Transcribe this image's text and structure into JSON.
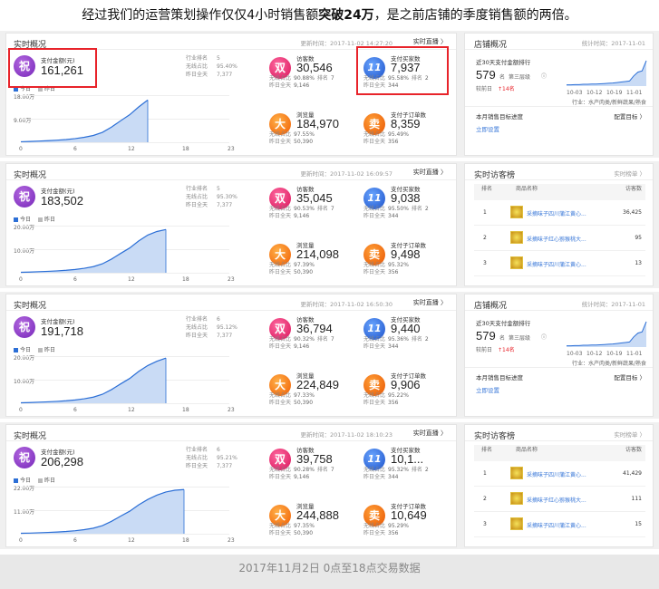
{
  "headline": {
    "prefix": "经过我们的运营策划操作仅仅4小时销售额",
    "bold": "突破24万",
    "suffix": "，是之前店铺的季度销售额的两倍。"
  },
  "colors": {
    "today": "#2c6fd6",
    "yesterday": "#bbbbbb",
    "fill": "#c9dbf5",
    "highlight": "#e8232a",
    "link": "#3a78d8"
  },
  "labels": {
    "realtime": "实时概况",
    "live": "实时直播 〉",
    "pay_amount": "支付金额(元)",
    "industry_rank": "行业排名",
    "wireless_ratio": "无线占比",
    "yesterday_all": "昨日全天",
    "today": "今日",
    "yesterday": "昨日",
    "visitors": "访客数",
    "buyers": "支付买家数",
    "pageviews": "浏览量",
    "orders": "支付子订单数",
    "rank": "排名",
    "badge_zhu": "祝",
    "badge_shuang": "双",
    "badge_11": "11",
    "badge_da": "大",
    "badge_mai": "卖"
  },
  "axis": {
    "x": [
      "0",
      "6",
      "12",
      "18",
      "23"
    ]
  },
  "rows": [
    {
      "update_time": "更新时间：2017-11-02 14:27:20",
      "pay_amount": "161,261",
      "industry_rank": "5",
      "wireless_ratio": "95.40%",
      "yesterday": "7,377",
      "y_ticks": [
        "18.00万",
        "9.00万"
      ],
      "y_max": 180000,
      "series": [
        [
          0,
          2000
        ],
        [
          1,
          3000
        ],
        [
          2,
          4500
        ],
        [
          3,
          6000
        ],
        [
          4,
          8000
        ],
        [
          5,
          10500
        ],
        [
          6,
          14000
        ],
        [
          7,
          19000
        ],
        [
          8,
          26000
        ],
        [
          9,
          38000
        ],
        [
          10,
          58000
        ],
        [
          11,
          82000
        ],
        [
          12,
          105000
        ],
        [
          13,
          135000
        ],
        [
          14,
          161261
        ]
      ],
      "visitors": {
        "value": "30,546",
        "ratio": "90.88%",
        "rank": "7",
        "yday": "9,146"
      },
      "buyers": {
        "value": "7,937",
        "ratio": "95.58%",
        "rank": "2",
        "yday": "344"
      },
      "pageviews": {
        "value": "184,970",
        "ratio": "97.55%",
        "yday": "50,390"
      },
      "orders": {
        "value": "8,359",
        "ratio": "95.49%",
        "yday": "356"
      }
    },
    {
      "update_time": "更新时间：2017-11-02 16:09:57",
      "pay_amount": "183,502",
      "industry_rank": "5",
      "wireless_ratio": "95.30%",
      "yesterday": "7,377",
      "y_ticks": [
        "20.00万",
        "10.00万"
      ],
      "y_max": 200000,
      "series": [
        [
          0,
          2000
        ],
        [
          1,
          3000
        ],
        [
          2,
          4500
        ],
        [
          3,
          6000
        ],
        [
          4,
          8000
        ],
        [
          5,
          10500
        ],
        [
          6,
          14000
        ],
        [
          7,
          19000
        ],
        [
          8,
          26000
        ],
        [
          9,
          38000
        ],
        [
          10,
          58000
        ],
        [
          11,
          82000
        ],
        [
          12,
          105000
        ],
        [
          13,
          135000
        ],
        [
          14,
          160000
        ],
        [
          15,
          175000
        ],
        [
          16,
          183502
        ]
      ],
      "visitors": {
        "value": "35,045",
        "ratio": "90.53%",
        "rank": "7",
        "yday": "9,146"
      },
      "buyers": {
        "value": "9,038",
        "ratio": "95.50%",
        "rank": "2",
        "yday": "344"
      },
      "pageviews": {
        "value": "214,098",
        "ratio": "97.39%",
        "yday": "50,390"
      },
      "orders": {
        "value": "9,498",
        "ratio": "95.32%",
        "yday": "356"
      }
    },
    {
      "update_time": "更新时间：2017-11-02 16:50:30",
      "pay_amount": "191,718",
      "industry_rank": "6",
      "wireless_ratio": "95.12%",
      "yesterday": "7,377",
      "y_ticks": [
        "20.00万",
        "10.00万"
      ],
      "y_max": 200000,
      "series": [
        [
          0,
          2000
        ],
        [
          1,
          3000
        ],
        [
          2,
          4500
        ],
        [
          3,
          6000
        ],
        [
          4,
          8000
        ],
        [
          5,
          10500
        ],
        [
          6,
          14000
        ],
        [
          7,
          19000
        ],
        [
          8,
          26000
        ],
        [
          9,
          38000
        ],
        [
          10,
          58000
        ],
        [
          11,
          82000
        ],
        [
          12,
          105000
        ],
        [
          13,
          135000
        ],
        [
          14,
          160000
        ],
        [
          15,
          178000
        ],
        [
          16,
          191718
        ]
      ],
      "visitors": {
        "value": "36,794",
        "ratio": "90.32%",
        "rank": "7",
        "yday": "9,146"
      },
      "buyers": {
        "value": "9,440",
        "ratio": "95.36%",
        "rank": "2",
        "yday": "344"
      },
      "pageviews": {
        "value": "224,849",
        "ratio": "97.33%",
        "yday": "50,390"
      },
      "orders": {
        "value": "9,906",
        "ratio": "95.22%",
        "yday": "356"
      }
    },
    {
      "update_time": "更新时间：2017-11-02 18:10:23",
      "pay_amount": "206,298",
      "industry_rank": "6",
      "wireless_ratio": "95.21%",
      "yesterday": "7,377",
      "y_ticks": [
        "22.00万",
        "11.00万"
      ],
      "y_max": 220000,
      "series": [
        [
          0,
          2000
        ],
        [
          1,
          3000
        ],
        [
          2,
          4500
        ],
        [
          3,
          6000
        ],
        [
          4,
          8000
        ],
        [
          5,
          10500
        ],
        [
          6,
          14000
        ],
        [
          7,
          19000
        ],
        [
          8,
          26000
        ],
        [
          9,
          38000
        ],
        [
          10,
          58000
        ],
        [
          11,
          82000
        ],
        [
          12,
          105000
        ],
        [
          13,
          135000
        ],
        [
          14,
          160000
        ],
        [
          15,
          180000
        ],
        [
          16,
          195000
        ],
        [
          17,
          203000
        ],
        [
          18,
          206298
        ]
      ],
      "visitors": {
        "value": "39,758",
        "ratio": "90.28%",
        "rank": "7",
        "yday": "9,146"
      },
      "buyers": {
        "value": "10,1...",
        "ratio": "95.32%",
        "rank": "2",
        "yday": "344"
      },
      "pageviews": {
        "value": "244,888",
        "ratio": "97.35%",
        "yday": "50,390"
      },
      "orders": {
        "value": "10,649",
        "ratio": "95.29%",
        "yday": "356"
      }
    }
  ],
  "shop": {
    "title": "店铺概况",
    "stat_time": "统计时间：2017-11-01",
    "rank_label": "近30天支付金额排行",
    "rank_value": "579",
    "rank_unit": "名",
    "tier": "第三层级",
    "prev_label": "较前日",
    "delta": "↑14名",
    "dates": [
      "10-03",
      "10-12",
      "10-19",
      "11-01"
    ],
    "industry": "行业：水产肉类/新鲜蔬果/熟食",
    "target_title": "本月销售目标进度",
    "target_link": "配置目标 〉",
    "setup": "立即设置",
    "trend": [
      [
        0,
        0.05
      ],
      [
        1,
        0.05
      ],
      [
        2,
        0.06
      ],
      [
        3,
        0.06
      ],
      [
        4,
        0.07
      ],
      [
        5,
        0.07
      ],
      [
        6,
        0.08
      ],
      [
        7,
        0.08
      ],
      [
        8,
        0.09
      ],
      [
        9,
        0.1
      ],
      [
        10,
        0.11
      ],
      [
        11,
        0.12
      ],
      [
        12,
        0.14
      ],
      [
        13,
        0.16
      ],
      [
        14,
        0.18
      ],
      [
        15,
        0.2
      ],
      [
        16,
        0.4
      ],
      [
        17,
        0.55
      ],
      [
        18,
        0.6
      ],
      [
        19,
        1.0
      ]
    ]
  },
  "visitor_panel": {
    "title": "实时访客榜",
    "live": "实时榜单 〉",
    "col_product": "商品名称",
    "col_visitors": "访客数",
    "lists": [
      [
        {
          "rank": "1",
          "name": "采摘味子四川蒲江黄心...",
          "visitors": "36,425"
        },
        {
          "rank": "2",
          "name": "采摘味子红心猕猴桃大...",
          "visitors": "95"
        },
        {
          "rank": "3",
          "name": "采摘味子四川蒲江黄心...",
          "visitors": "13"
        }
      ],
      [
        {
          "rank": "1",
          "name": "采摘味子四川蒲江黄心...",
          "visitors": "41,429"
        },
        {
          "rank": "2",
          "name": "采摘味子红心猕猴桃大...",
          "visitors": "111"
        },
        {
          "rank": "3",
          "name": "采摘味子四川蒲江黄心...",
          "visitors": "15"
        }
      ]
    ]
  },
  "footer": "2017年11月2日 0点至18点交易数据"
}
